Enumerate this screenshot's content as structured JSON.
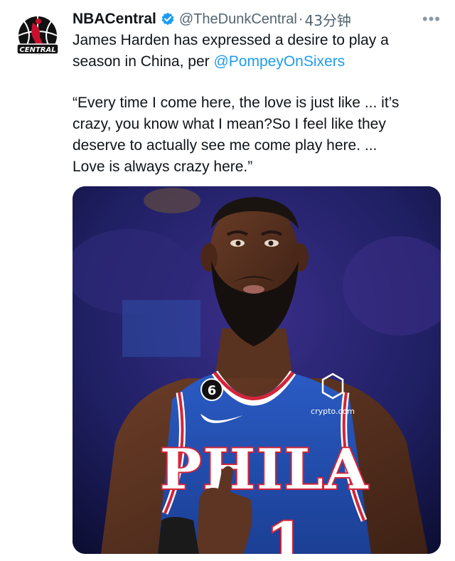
{
  "tweet": {
    "display_name": "NBACentral",
    "handle": "@TheDunkCentral",
    "separator": "·",
    "time": "43分钟",
    "more": "•••",
    "line1_a": "James Harden has expressed a desire to play a",
    "line1_b_prefix": "season in China, per ",
    "mention": "@PompeyOnSixers",
    "quote_lines": [
      "“Every time I come here, the love is just like ... it’s",
      "crazy, you know what I mean?So I feel like they",
      "deserve to actually see me come play here. ...",
      "Love is always crazy here.”"
    ]
  },
  "avatar": {
    "logo_text": "CENTRAL",
    "icon": "basketball-logo-icon"
  },
  "media": {
    "jersey_team": "PHILA",
    "jersey_number": "1",
    "patch_number": "6",
    "sponsor": "crypto.com"
  },
  "colors": {
    "accent": "#1d9bf0",
    "secondary_text": "#536471",
    "jersey_blue": "#1f4fb0",
    "jersey_red": "#d3253a"
  }
}
